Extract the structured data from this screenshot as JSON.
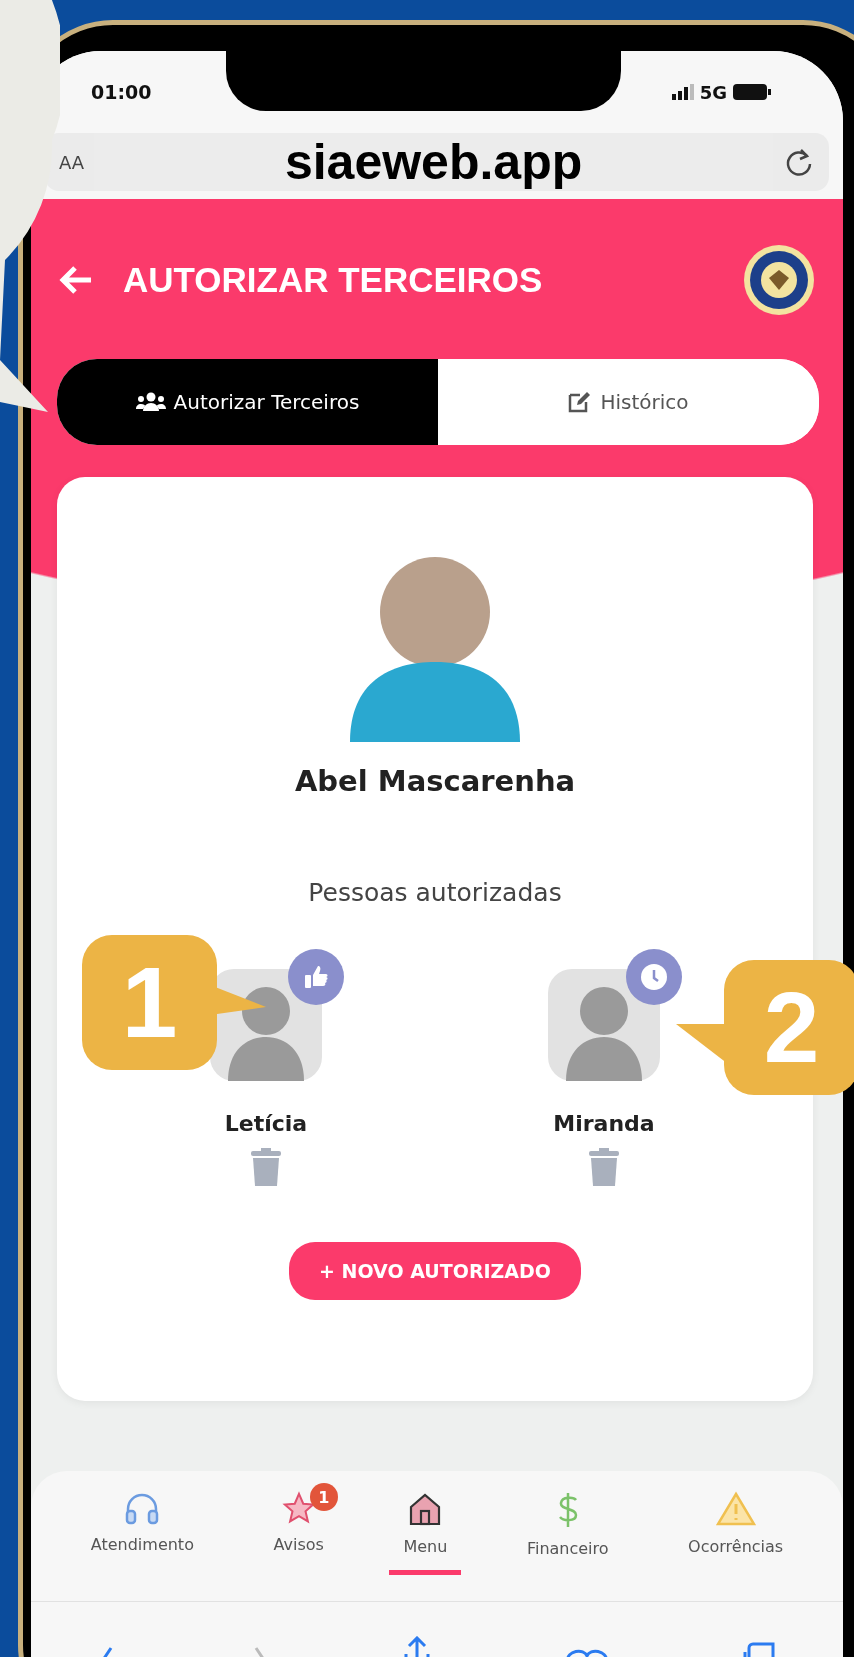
{
  "status_bar": {
    "time": "01:00",
    "network": "5G"
  },
  "browser": {
    "text_size": "AA",
    "url": "siaeweb.app"
  },
  "header": {
    "title": "AUTORIZAR TERCEIROS"
  },
  "tabs": [
    {
      "label": "Autorizar Terceiros",
      "kind": "people",
      "selected": true
    },
    {
      "label": "Histórico",
      "kind": "edit",
      "selected": false
    }
  ],
  "student": {
    "name": "Abel Mascarenha"
  },
  "section_title": "Pessoas autorizadas",
  "people": [
    {
      "name": "Letícia",
      "kind": "approved"
    },
    {
      "name": "Miranda",
      "kind": "pending"
    }
  ],
  "add_button": "+ NOVO AUTORIZADO",
  "nav": [
    {
      "label": "Atendimento",
      "kind": "headphones",
      "selected": false
    },
    {
      "label": "Avisos",
      "kind": "star",
      "badge": "1",
      "selected": false
    },
    {
      "label": "Menu",
      "kind": "home",
      "selected": true
    },
    {
      "label": "Financeiro",
      "kind": "dollar",
      "selected": false
    },
    {
      "label": "Ocorrências",
      "kind": "warning",
      "selected": false
    }
  ],
  "callouts": [
    {
      "label": "1",
      "kind": "left"
    },
    {
      "label": "2",
      "kind": "right"
    }
  ]
}
